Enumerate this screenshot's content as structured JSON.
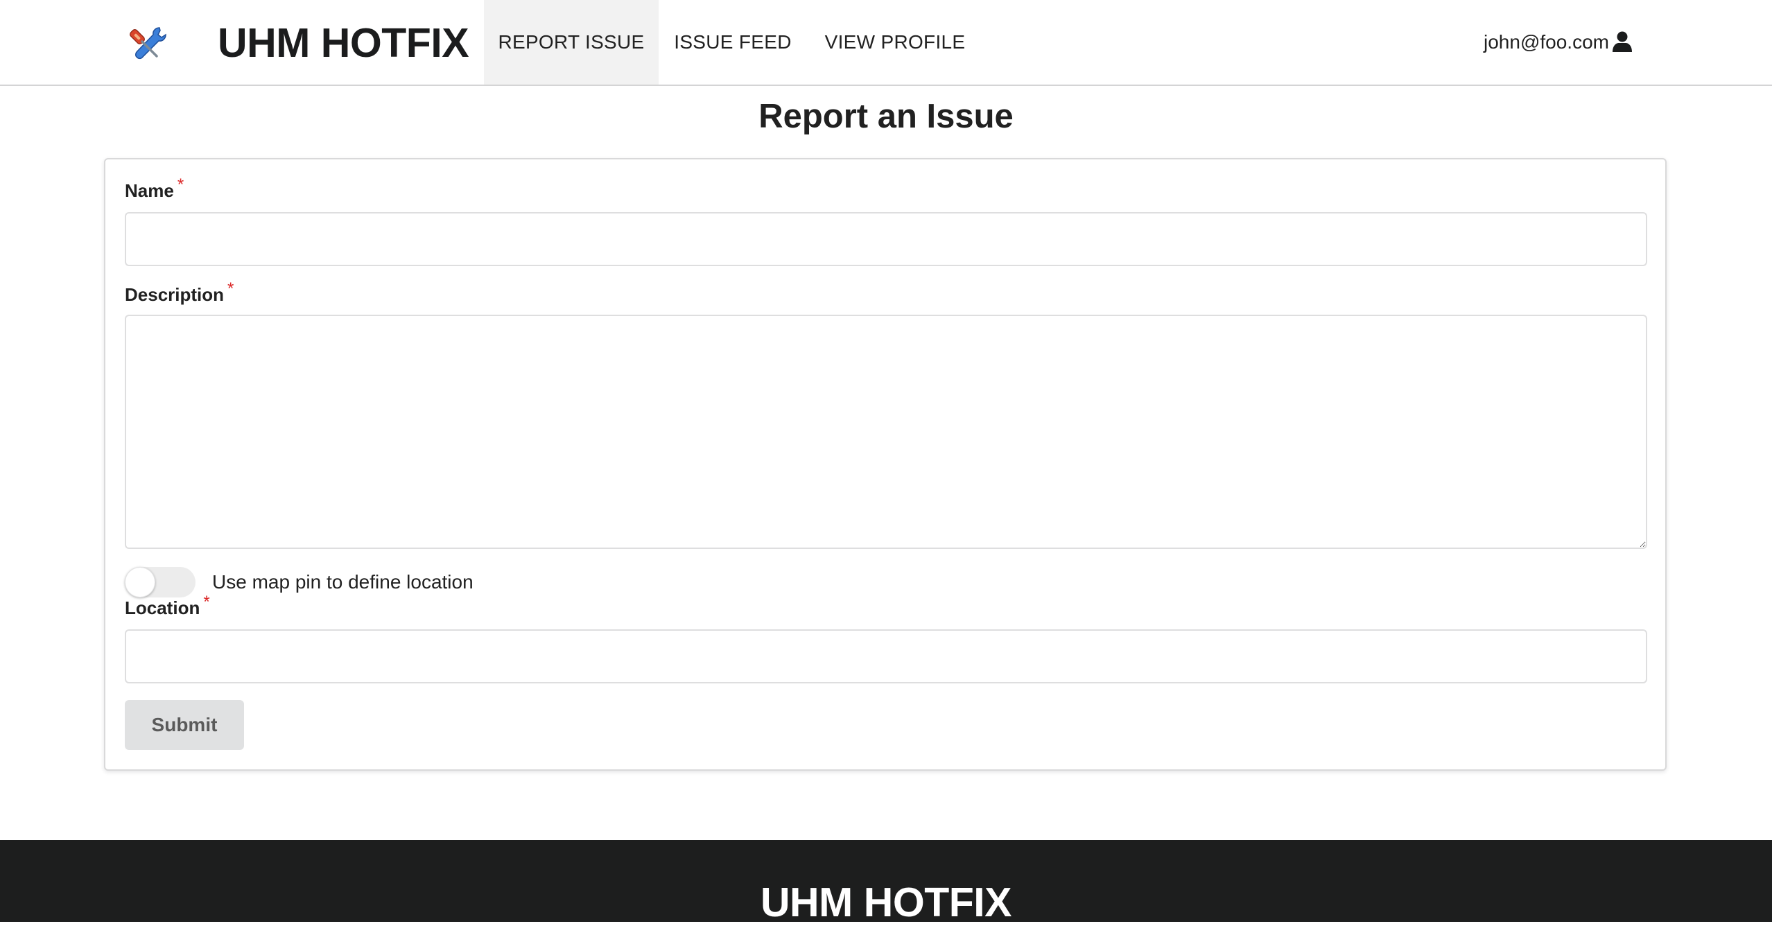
{
  "navbar": {
    "brand_icon": "tools-icon",
    "brand_title": "UHM HOTFIX",
    "items": [
      {
        "label": "REPORT ISSUE",
        "active": true
      },
      {
        "label": "ISSUE FEED",
        "active": false
      },
      {
        "label": "VIEW PROFILE",
        "active": false
      }
    ],
    "user": {
      "email": "john@foo.com",
      "icon": "user-icon"
    }
  },
  "page": {
    "title": "Report an Issue"
  },
  "form": {
    "name": {
      "label": "Name",
      "required_mark": "*",
      "value": "",
      "placeholder": ""
    },
    "description": {
      "label": "Description",
      "required_mark": "*",
      "value": "",
      "placeholder": ""
    },
    "map_toggle": {
      "label": "Use map pin to define location",
      "checked": false
    },
    "location": {
      "label": "Location",
      "required_mark": "*",
      "value": "",
      "placeholder": ""
    },
    "submit_label": "Submit"
  },
  "footer": {
    "title": "UHM HOTFIX"
  },
  "colors": {
    "required": "#db2828",
    "footer_bg": "#1d1e1e",
    "active_nav_bg": "#f2f2f2",
    "button_bg": "#e0e1e2"
  }
}
